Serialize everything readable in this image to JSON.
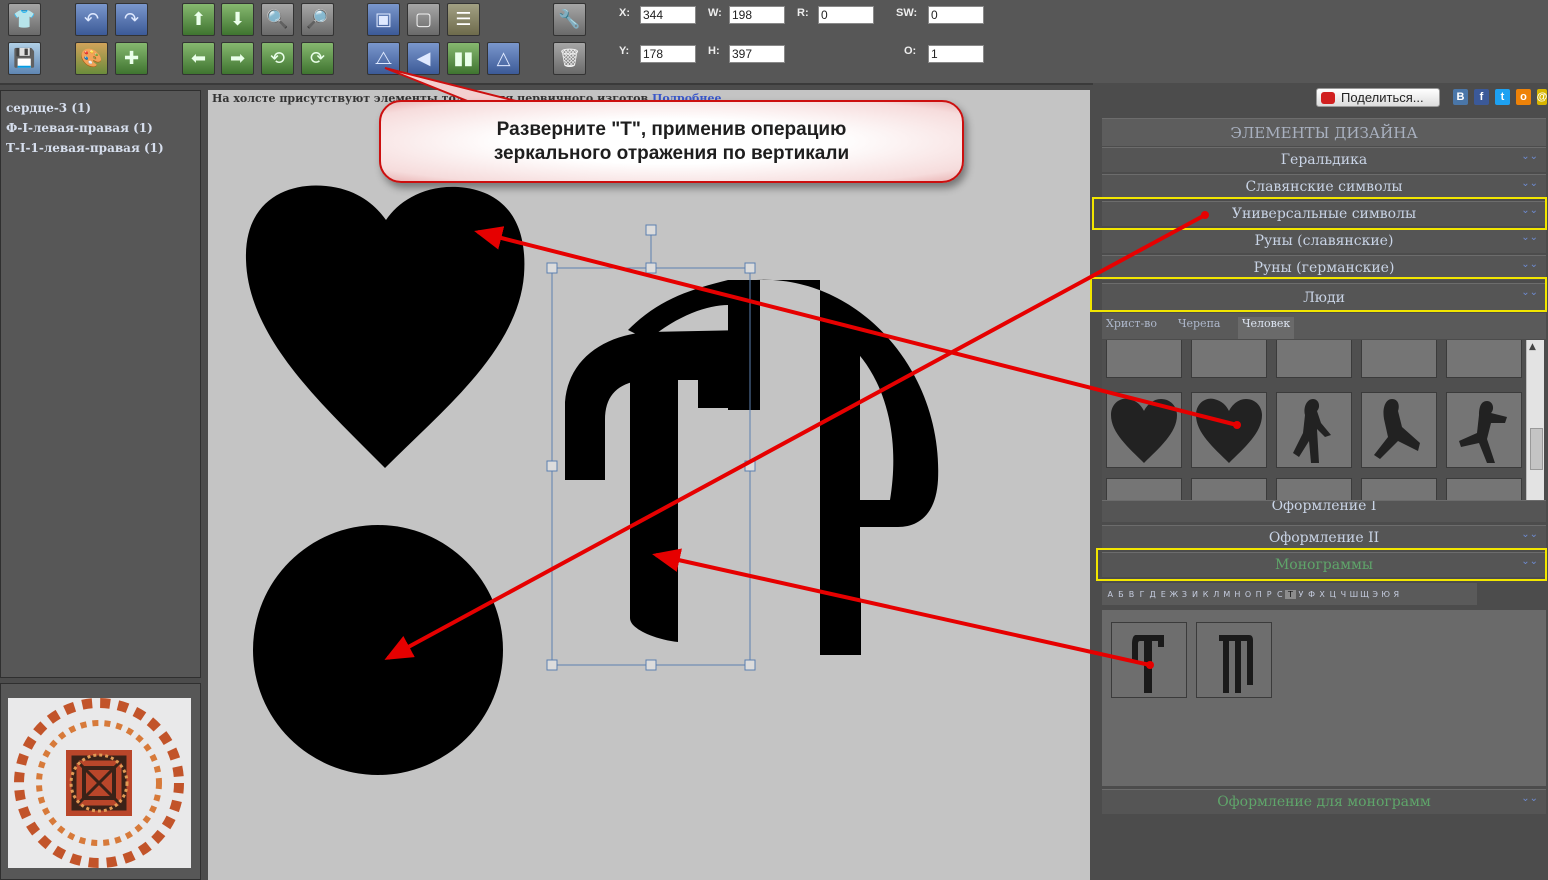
{
  "toolbar": {
    "icons": [
      "shirt-icon",
      "save-icon",
      "undo-icon",
      "redo-icon",
      "palette-icon",
      "add-image-icon",
      "arrow-up-icon",
      "arrow-down-icon",
      "arrow-left-icon",
      "arrow-right-icon",
      "zoom-in-icon",
      "zoom-out-icon",
      "rotate-left-icon",
      "rotate-right-icon",
      "bring-front-icon",
      "send-back-icon",
      "align-icon",
      "flip-vertical-icon",
      "flip-horizontal-icon",
      "group-icon",
      "triangle-icon",
      "tools-icon",
      "trash-icon"
    ],
    "fields": {
      "x": {
        "label": "X:",
        "value": "344"
      },
      "w": {
        "label": "W:",
        "value": "198"
      },
      "r": {
        "label": "R:",
        "value": "0"
      },
      "sw": {
        "label": "SW:",
        "value": "0"
      },
      "y": {
        "label": "Y:",
        "value": "178"
      },
      "h": {
        "label": "H:",
        "value": "397"
      },
      "o": {
        "label": "O:",
        "value": "1"
      }
    }
  },
  "layers": [
    "сердце-3 (1)",
    "Ф-I-левая-правая (1)",
    "Т-I-1-левая-правая (1)"
  ],
  "canvas": {
    "note": "На холсте присутствуют элемент",
    "note_hidden_end": "ы только для первичного изготов",
    "note_link": "Подробнее"
  },
  "callout": {
    "line1": "Разверните \"Т\", применив операцию",
    "line2": "зеркального отражения по вертикали"
  },
  "share": {
    "label": "Поделиться..."
  },
  "social": [
    {
      "name": "vkontakte-icon",
      "glyph": "B",
      "color": "#4a76a8"
    },
    {
      "name": "facebook-icon",
      "glyph": "f",
      "color": "#3b5998"
    },
    {
      "name": "twitter-icon",
      "glyph": "t",
      "color": "#1da1f2"
    },
    {
      "name": "odnoklassniki-icon",
      "glyph": "o",
      "color": "#ee8208"
    }
  ],
  "design_panel": {
    "title": "ЭЛЕМЕНТЫ ДИЗАЙНА",
    "sections": [
      {
        "label": "Геральдика",
        "highlight": false
      },
      {
        "label": "Славянские символы",
        "highlight": false
      },
      {
        "label": "Универсальные символы",
        "highlight": true
      },
      {
        "label": "Руны (славянские)",
        "highlight": false
      },
      {
        "label": "Руны (германские)",
        "highlight": false
      },
      {
        "label": "Люди",
        "highlight": true
      }
    ],
    "tabs": [
      "Христ-во",
      "Черепа",
      "Человек"
    ],
    "active_tab": "Человек",
    "lower_sections": [
      {
        "label": "Оформление I",
        "highlight": false
      },
      {
        "label": "Оформление II",
        "highlight": false
      },
      {
        "label": "Монограммы",
        "highlight": true
      }
    ],
    "letters": [
      "А",
      "Б",
      "В",
      "Г",
      "Д",
      "Е",
      "Ж",
      "З",
      "И",
      "К",
      "Л",
      "М",
      "Н",
      "О",
      "П",
      "Р",
      "С",
      "Т",
      "У",
      "Ф",
      "Х",
      "Ц",
      "Ч",
      "Ш",
      "Щ",
      "Э",
      "Ю",
      "Я"
    ],
    "active_letter": "Т",
    "bottom_section": "Оформление для монограмм"
  },
  "colors": {
    "accent_highlight": "#f2e600",
    "annotation_red": "#e60000",
    "section_text": "#c9d4e6",
    "monogram_text": "#5fa56a",
    "link": "#3a57c9"
  }
}
